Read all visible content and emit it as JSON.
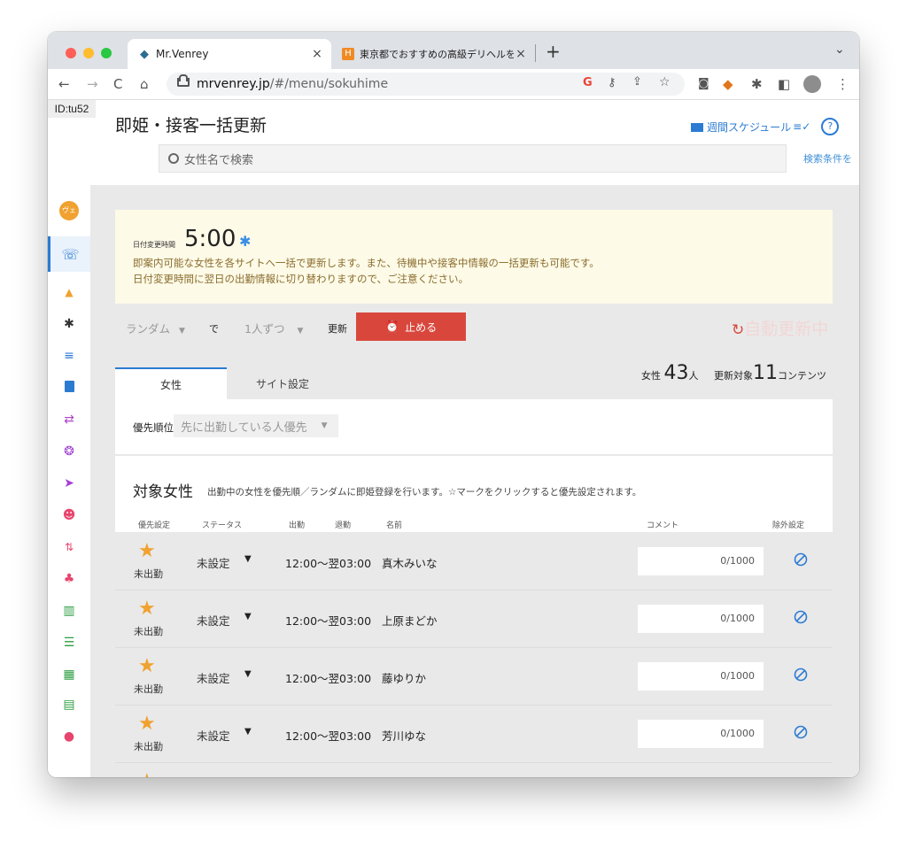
{
  "browser": {
    "tabs": [
      {
        "title": "Mr.Venrey",
        "close": "×"
      },
      {
        "title": "東京都でおすすめの高級デリヘルを",
        "close": "×"
      }
    ],
    "new_tab": "+",
    "tab_menu": "⌄",
    "url_host": "mrvenrey.jp",
    "url_path": "/#/menu/sokuhime"
  },
  "sidebar": {
    "account_id": "ID:tu52",
    "avatar_label": "ヴェ"
  },
  "header": {
    "title": "即姫・接客一括更新",
    "weekly_schedule": "週間スケジュール",
    "search_placeholder": "女性名で検索",
    "search_conditions": "検索条件を"
  },
  "notice": {
    "label": "日付変更時間",
    "time": "5:00",
    "line1": "即案内可能な女性を各サイトへ一括で更新します。また、待機中や接客中情報の一括更新も可能です。",
    "line2": "日付変更時間に翌日の出勤情報に切り替わりますので、ご注意ください。"
  },
  "controls": {
    "mode": "ランダム",
    "de": "で",
    "count": "1人ずつ",
    "update": "更新",
    "stop_button": "止める",
    "auto_status": "自動更新中"
  },
  "tabs": [
    {
      "label": "女性"
    },
    {
      "label": "サイト設定"
    }
  ],
  "counts": {
    "women_label": "女性",
    "women_count": "43",
    "women_unit": "人",
    "target_label": "更新対象",
    "target_count": "11",
    "target_unit": "コンテンツ"
  },
  "priority": {
    "label": "優先順位",
    "selected": "先に出勤している人優先"
  },
  "list": {
    "heading": "対象女性",
    "description": "出勤中の女性を優先順／ランダムに即姫登録を行います。☆マークをクリックすると優先設定されます。",
    "columns": {
      "priority": "優先設定",
      "status": "ステータス",
      "in": "出勤",
      "out": "退勤",
      "name": "名前",
      "comment": "コメント",
      "exclude": "除外設定"
    },
    "rows": [
      {
        "attendance": "未出勤",
        "status": "未設定",
        "hours": "12:00～翌03:00",
        "name": "真木みいな",
        "comment_count": "0/1000"
      },
      {
        "attendance": "未出勤",
        "status": "未設定",
        "hours": "12:00～翌03:00",
        "name": "上原まどか",
        "comment_count": "0/1000"
      },
      {
        "attendance": "未出勤",
        "status": "未設定",
        "hours": "12:00～翌03:00",
        "name": "藤ゆりか",
        "comment_count": "0/1000"
      },
      {
        "attendance": "未出勤",
        "status": "未設定",
        "hours": "12:00～翌03:00",
        "name": "芳川ゆな",
        "comment_count": "0/1000"
      }
    ]
  },
  "colors": {
    "accent_blue": "#2b7bd3",
    "stop_red": "#d9473c",
    "star_orange": "#f0a12f",
    "notice_bg": "#fdfae7"
  }
}
